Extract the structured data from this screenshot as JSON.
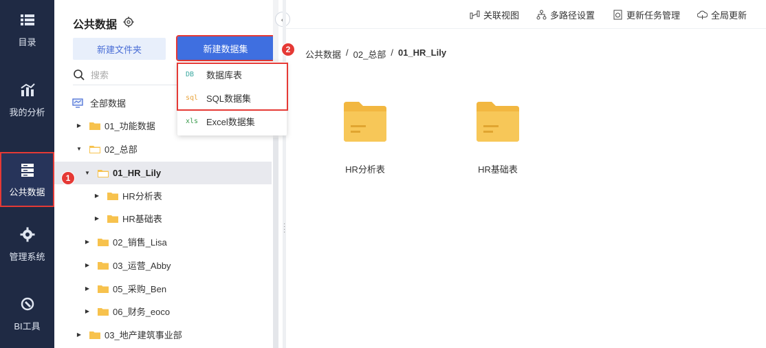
{
  "rail": {
    "items": [
      {
        "label": "目录",
        "icon": "list-icon"
      },
      {
        "label": "我的分析",
        "icon": "chart-icon"
      },
      {
        "label": "公共数据",
        "icon": "database-icon",
        "active": true
      },
      {
        "label": "管理系统",
        "icon": "gear-icon"
      },
      {
        "label": "BI工具",
        "icon": "wrench-icon"
      }
    ]
  },
  "tree": {
    "title": "公共数据",
    "new_folder_label": "新建文件夹",
    "new_dataset_label": "新建数据集",
    "search_placeholder": "搜索",
    "all_data_label": "全部数据",
    "nodes": [
      {
        "label": "01_功能数据"
      },
      {
        "label": "02_总部"
      },
      {
        "label": "01_HR_Lily"
      },
      {
        "label": "HR分析表"
      },
      {
        "label": "HR基础表"
      },
      {
        "label": "02_销售_Lisa"
      },
      {
        "label": "03_运营_Abby"
      },
      {
        "label": "05_采购_Ben"
      },
      {
        "label": "06_财务_eoco"
      },
      {
        "label": "03_地产建筑事业部"
      }
    ]
  },
  "dropdown": {
    "items": [
      {
        "tag": "DB",
        "label": "数据库表",
        "color": "#3aa8a0"
      },
      {
        "tag": "sql",
        "label": "SQL数据集",
        "color": "#e8a33d"
      },
      {
        "tag": "xls",
        "label": "Excel数据集",
        "color": "#3a9a4c"
      }
    ]
  },
  "badges": {
    "one": "1",
    "two": "2"
  },
  "toolbar": {
    "items": [
      {
        "label": "关联视图",
        "icon": "relation-icon"
      },
      {
        "label": "多路径设置",
        "icon": "hierarchy-icon"
      },
      {
        "label": "更新任务管理",
        "icon": "update-task-icon"
      },
      {
        "label": "全局更新",
        "icon": "cloud-refresh-icon"
      }
    ]
  },
  "breadcrumb": {
    "items": [
      "公共数据",
      "02_总部"
    ],
    "separator": "/",
    "current": "01_HR_Lily"
  },
  "cards": [
    {
      "label": "HR分析表"
    },
    {
      "label": "HR基础表"
    }
  ],
  "colors": {
    "rail_bg": "#1f2a44",
    "primary": "#3f6fe0",
    "folder": "#f7c24d",
    "highlight": "#e53935"
  }
}
